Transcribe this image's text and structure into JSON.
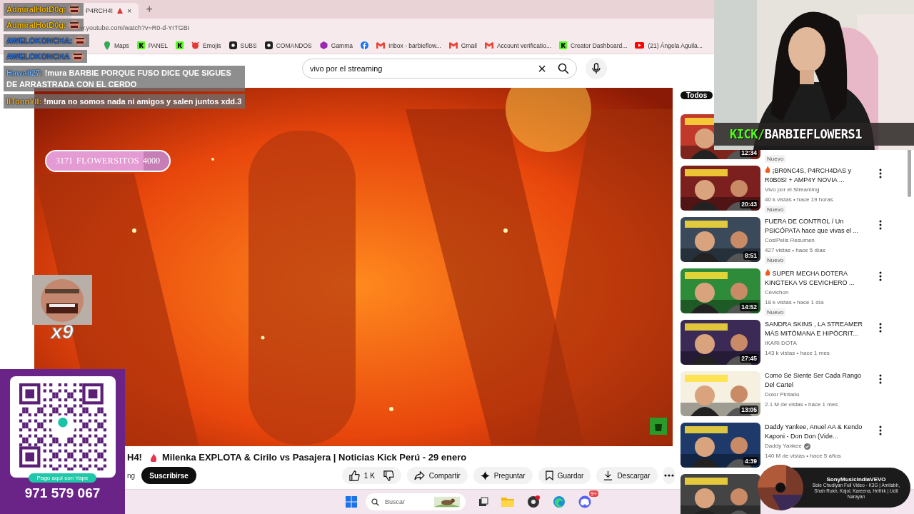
{
  "browser": {
    "tab": {
      "title": "P4RCH4!",
      "close": "×",
      "new_tab": "+"
    },
    "address": "w.youtube.com/watch?v=R0-d-YrTGBI",
    "bookmarks": [
      {
        "kind": "pin",
        "label": "Maps"
      },
      {
        "kind": "kick",
        "label": "PANEL"
      },
      {
        "kind": "kick"
      },
      {
        "kind": "emoji",
        "label": "Emojis"
      },
      {
        "kind": "discord",
        "label": "SUBS"
      },
      {
        "kind": "discord",
        "label": "COMANDOS"
      },
      {
        "kind": "gamma",
        "label": "Gamma"
      },
      {
        "kind": "facebook"
      },
      {
        "kind": "gmail",
        "label": "Inbox - barbieflow..."
      },
      {
        "kind": "gmail",
        "label": "Gmail"
      },
      {
        "kind": "gmail",
        "label": "Account verificatio..."
      },
      {
        "kind": "kick",
        "label": "Creator Dashboard..."
      },
      {
        "kind": "youtube",
        "label": "(21) Ángela Aguila..."
      }
    ]
  },
  "search": {
    "value": "vivo por el streaming",
    "clear": "×"
  },
  "title": {
    "start": "H4!",
    "text": "Milenka EXPLOTA & Cirilo vs Pasajera | Noticias Kick Perú - 29 enero",
    "channel": "ng"
  },
  "actions": {
    "subscribe": "Suscribirse",
    "likes": "1 K",
    "buttons": [
      {
        "kind": "share",
        "label": "Compartir"
      },
      {
        "kind": "ask",
        "label": "Preguntar"
      },
      {
        "kind": "save",
        "label": "Guardar"
      },
      {
        "kind": "download",
        "label": "Descargar"
      }
    ]
  },
  "sidebar": {
    "chip": {
      "label": "Todos",
      "selected": true
    },
    "videos": [
      {
        "kind": "video",
        "duration": "12:34",
        "badge": "Nuevo"
      },
      {
        "kind": "video",
        "title": "¡BR0NC4S, P4RCH4DAS y R0B0S! + AMP4Y NOVIA ...",
        "lead_icon": true,
        "channel": "Vivo por el Streaming",
        "views": "40 k vistas • hace 19 horas",
        "badge": "Nuevo",
        "duration": "20:43"
      },
      {
        "kind": "video",
        "title": "FUERA DE CONTROL / Un PSICÓPATA hace que vivas el ...",
        "channel": "CosiPelis Resumen",
        "views": "427 vistas • hace 5 días",
        "badge": "Nuevo",
        "duration": "8:51"
      },
      {
        "kind": "video",
        "title": "SUPER MECHA DOTERA KINGTEKA VS CEVICHERO ...",
        "lead_icon": true,
        "channel": "Cevichon",
        "views": "18 k vistas • hace 1 día",
        "badge": "Nuevo",
        "duration": "14:52"
      },
      {
        "kind": "video",
        "title": "SANDRA SKINS , LA STREAMER MÁS MITÓMANA E HIPÓCRIT...",
        "channel": "IKARI DOTA",
        "views": "143 k vistas • hace 1 mes",
        "duration": "27:45"
      },
      {
        "kind": "video",
        "title": "Como Se Siente Ser Cada Rango Del Cartel",
        "channel": "Dolor Pintado",
        "views": "2.1 M de vistas • hace 1 mes",
        "duration": "13:05"
      },
      {
        "kind": "video",
        "title": "Daddy Yankee, Anuel AA & Kendo Kaponi - Don Don (Vide...",
        "channel": "Daddy Yankee",
        "verified": true,
        "views": "140 M de vistas • hace 5 años",
        "duration": "4:39"
      },
      {
        "kind": "video"
      }
    ]
  },
  "chat": [
    {
      "kind": "emote",
      "user": "AdmiralHotD0g:",
      "color": "#f5b800"
    },
    {
      "kind": "emote",
      "user": "AdmiralHotD0g:",
      "color": "#f5b800"
    },
    {
      "kind": "emote",
      "user": "AWELOKONCHA:",
      "color": "#2f6fd8"
    },
    {
      "kind": "emote",
      "user": "AWELOKONCHA",
      "color": "#2f6fd8"
    },
    {
      "kind": "text",
      "user": "Hawaii27:",
      "color": "#6fb4ff",
      "text": "!mura BARBIE PORQUE FUSO DICE QUE SIGUES DE ARRASTRADA CON EL CERDO"
    },
    {
      "kind": "text",
      "user": "IITonnYII:",
      "color": "#f0b040",
      "text": "!mura no somos nada ni amigos y salen juntos xdd.3"
    }
  ],
  "goal": {
    "current": "3171",
    "label": "FLOWERSITOS",
    "target": "4000",
    "level": 0.79
  },
  "combo": {
    "count": "x9"
  },
  "webcam": {
    "handle_prefix": "KICK/",
    "handle": "BARBIEFLOWERS1"
  },
  "donation": {
    "caption": "Pago aquí con Yape",
    "phone": "971 579 067"
  },
  "taskbar": {
    "search": "Buscar",
    "discord_badge": "9+"
  },
  "notification": {
    "title": "SonyMusicIndiaVEVO",
    "body": "Bole Chudiyan Full Video - K3G | Amitabh, Shah Rukh, Kajol, Kareena, Hrithik | Udit Narayan"
  }
}
